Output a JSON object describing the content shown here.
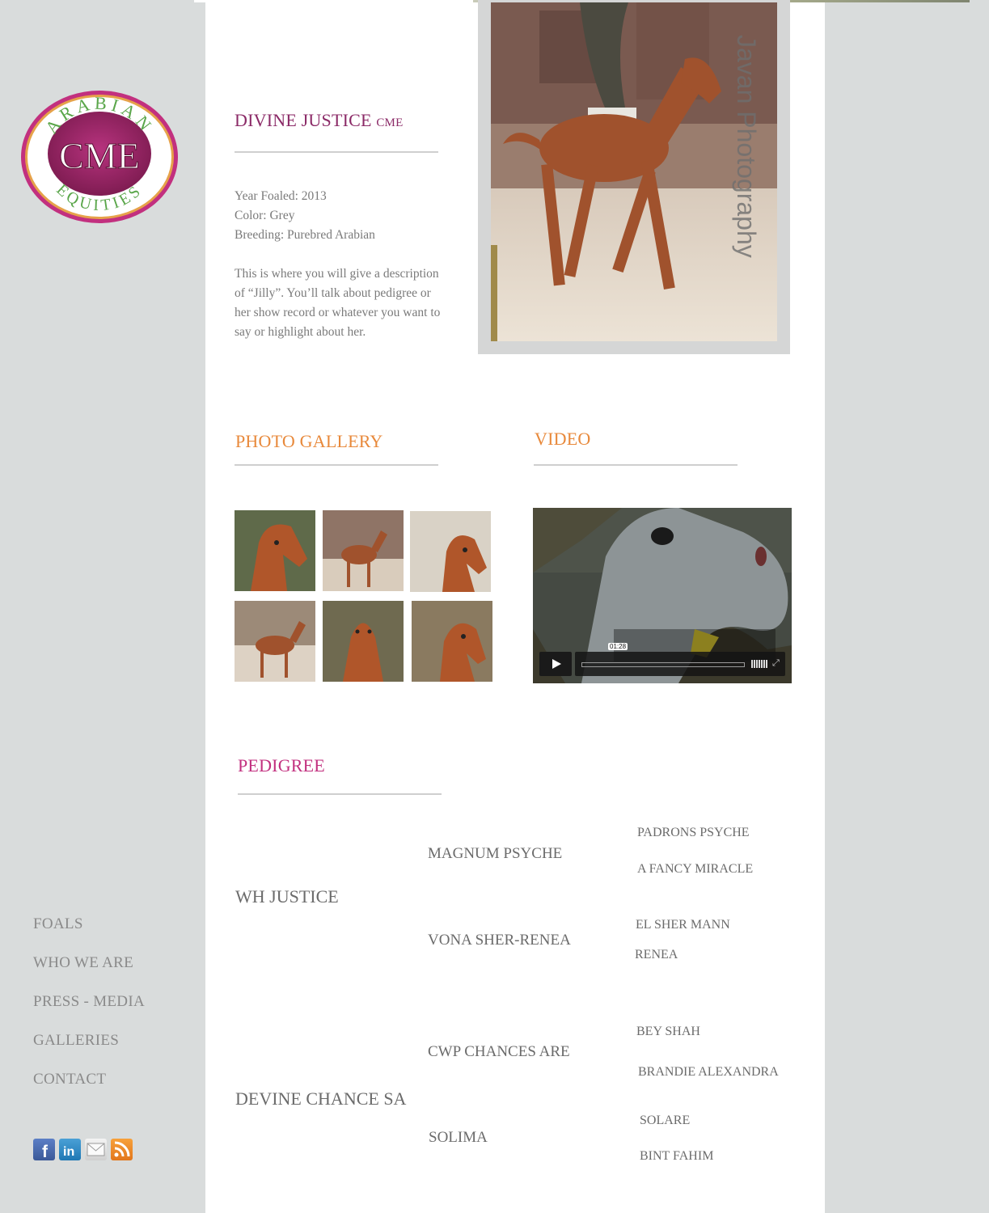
{
  "horse": {
    "name": "DIVINE JUSTICE",
    "suffix": "CME",
    "year_foaled": "Year Foaled: 2013",
    "color": "Color: Grey",
    "breeding": "Breeding: Purebred Arabian",
    "description": "This is where you will give a description of “Jilly”. You’ll talk about pedigree or her show record or whatever you want to say or highlight about her."
  },
  "logo": {
    "top_text": "ARABIAN",
    "center_text": "CME",
    "bottom_text": "EQUITIES"
  },
  "photo": {
    "watermark": "Javan Photography"
  },
  "sections": {
    "gallery_title": "PHOTO GALLERY",
    "video_title": "VIDEO",
    "pedigree_title": "PEDIGREE"
  },
  "video": {
    "time": "01:28"
  },
  "nav": {
    "items": [
      "FOALS",
      "WHO WE ARE",
      "PRESS - MEDIA",
      "GALLERIES",
      "CONTACT"
    ]
  },
  "social": [
    "facebook-icon",
    "linkedin-icon",
    "email-icon",
    "rss-icon"
  ],
  "pedigree": {
    "sire": "WH JUSTICE",
    "dam": "DEVINE CHANCE SA",
    "sire_sire": "MAGNUM PSYCHE",
    "sire_dam": "VONA SHER-RENEA",
    "dam_sire": "CWP CHANCES ARE",
    "dam_dam": "SOLIMA",
    "ss_sire": "PADRONS PSYCHE",
    "ss_dam": "A FANCY MIRACLE",
    "sd_sire": "EL SHER MANN",
    "sd_dam": "RENEA",
    "ds_sire": "BEY SHAH",
    "ds_dam": "BRANDIE ALEXANDRA",
    "dd_sire": "SOLARE",
    "dd_dam": "BINT FAHIM"
  },
  "colors": {
    "background": "#d9dcdc",
    "name_heading": "#8b2a67",
    "section_orange": "#e8893b",
    "pedigree_magenta": "#c2307f",
    "text": "#7a7a7a"
  }
}
